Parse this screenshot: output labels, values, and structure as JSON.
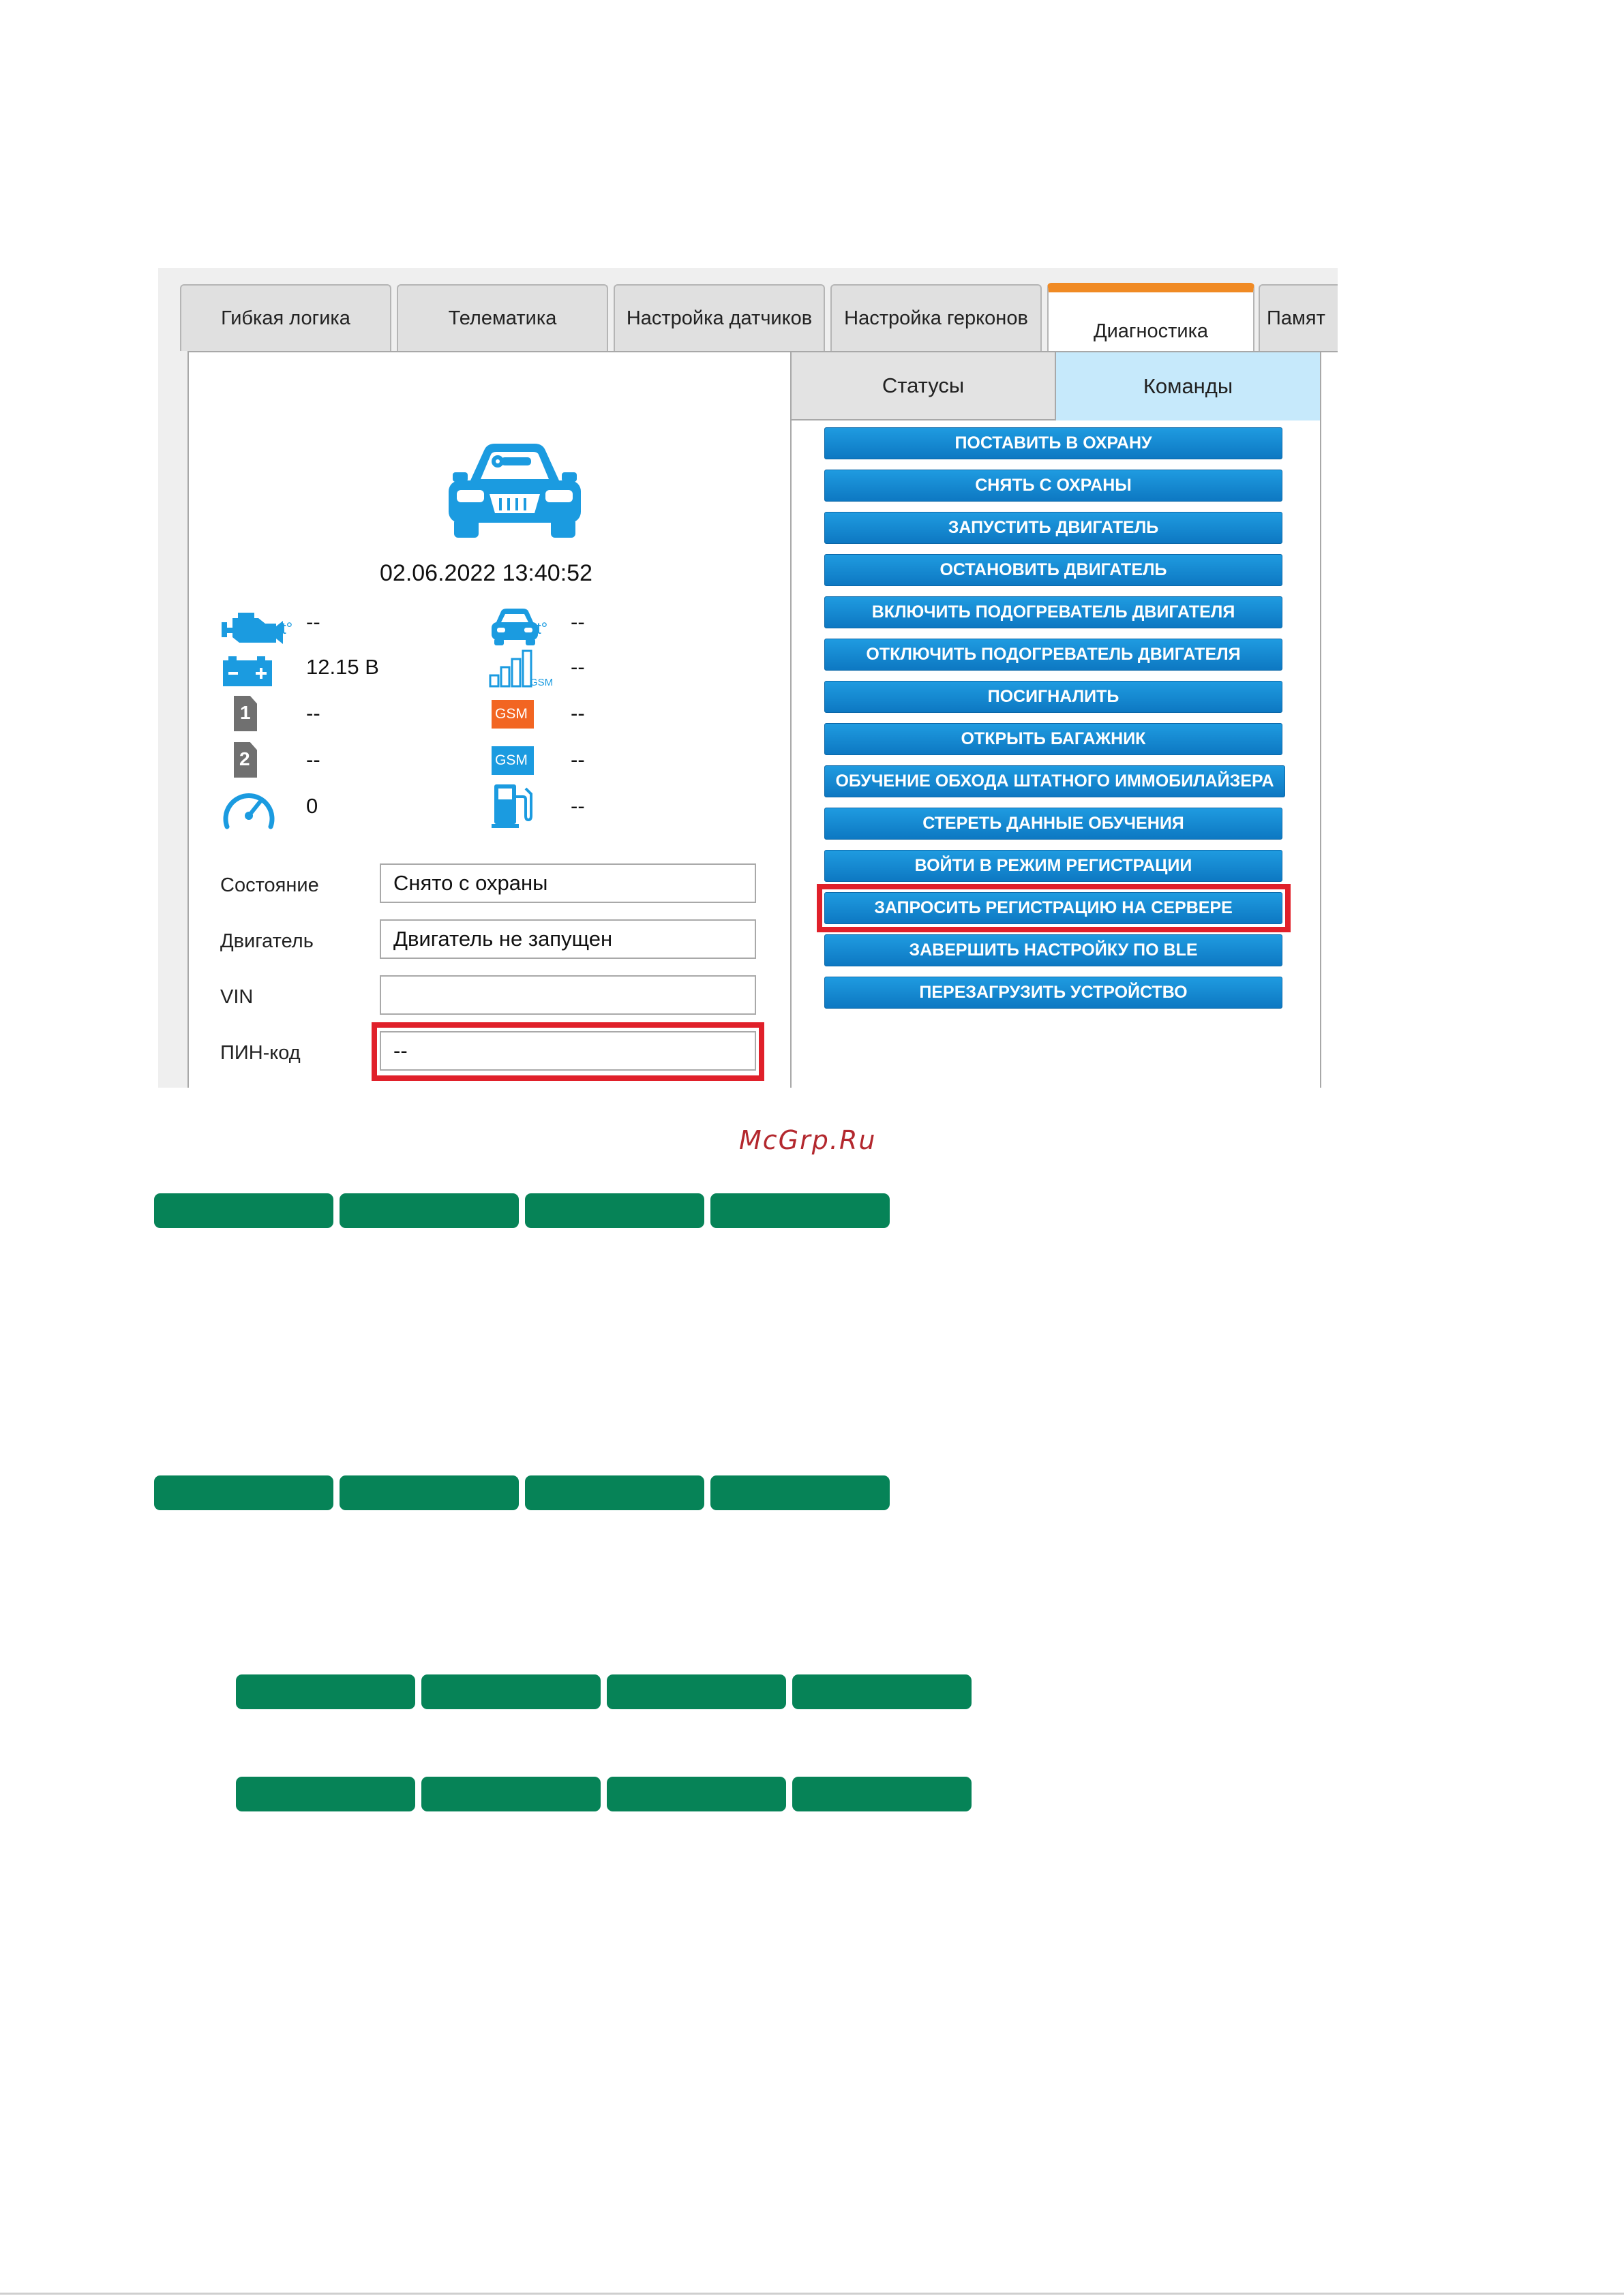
{
  "tabs": [
    "Гибкая логика",
    "Телематика",
    "Настройка датчиков",
    "Настройка герконов",
    "Диагностика",
    "Памят"
  ],
  "active_tab": "Диагностика",
  "subtabs": {
    "statuses": "Статусы",
    "commands": "Команды"
  },
  "datetime": "02.06.2022  13:40:52",
  "sensors": {
    "engine_temp": "--",
    "cabin_temp": "--",
    "battery": "12.15 В",
    "gsm_signal": "--",
    "sim1": "--",
    "gsm1": "--",
    "sim2": "--",
    "gsm2": "--",
    "speed": "0",
    "fuel": "--"
  },
  "icon_text": {
    "sim1": "1",
    "sim2": "2",
    "gsm": "GSM",
    "gsm_signal_sub": "GSM",
    "temp_sup": "t°"
  },
  "fields": {
    "state_label": "Состояние",
    "state_value": "Снято с охраны",
    "engine_label": "Двигатель",
    "engine_value": "Двигатель не запущен",
    "vin_label": "VIN",
    "vin_value": "",
    "pin_label": "ПИН-код",
    "pin_value": "--"
  },
  "commands": [
    "ПОСТАВИТЬ В ОХРАНУ",
    "СНЯТЬ С ОХРАНЫ",
    "ЗАПУСТИТЬ ДВИГАТЕЛЬ",
    "ОСТАНОВИТЬ ДВИГАТЕЛЬ",
    "ВКЛЮЧИТЬ ПОДОГРЕВАТЕЛЬ ДВИГАТЕЛЯ",
    "ОТКЛЮЧИТЬ ПОДОГРЕВАТЕЛЬ ДВИГАТЕЛЯ",
    "ПОСИГНАЛИТЬ",
    "ОТКРЫТЬ БАГАЖНИК",
    "ОБУЧЕНИЕ ОБХОДА ШТАТНОГО ИММОБИЛАЙЗЕРА",
    "СТЕРЕТЬ ДАННЫЕ ОБУЧЕНИЯ",
    "ВОЙТИ В РЕЖИМ РЕГИСТРАЦИИ",
    "ЗАПРОСИТЬ РЕГИСТРАЦИЮ НА СЕРВЕРЕ",
    "ЗАВЕРШИТЬ НАСТРОЙКУ ПО BLE",
    "ПЕРЕЗАГРУЗИТЬ УСТРОЙСТВО"
  ],
  "watermark": "McGrp.Ru",
  "colors": {
    "accent_tab": "#f08a24",
    "command_button": "#1489d4",
    "highlight": "#e0202a",
    "icon_blue": "#1b9be0",
    "gsm_orange": "#f26522",
    "redaction_green": "#068357"
  }
}
